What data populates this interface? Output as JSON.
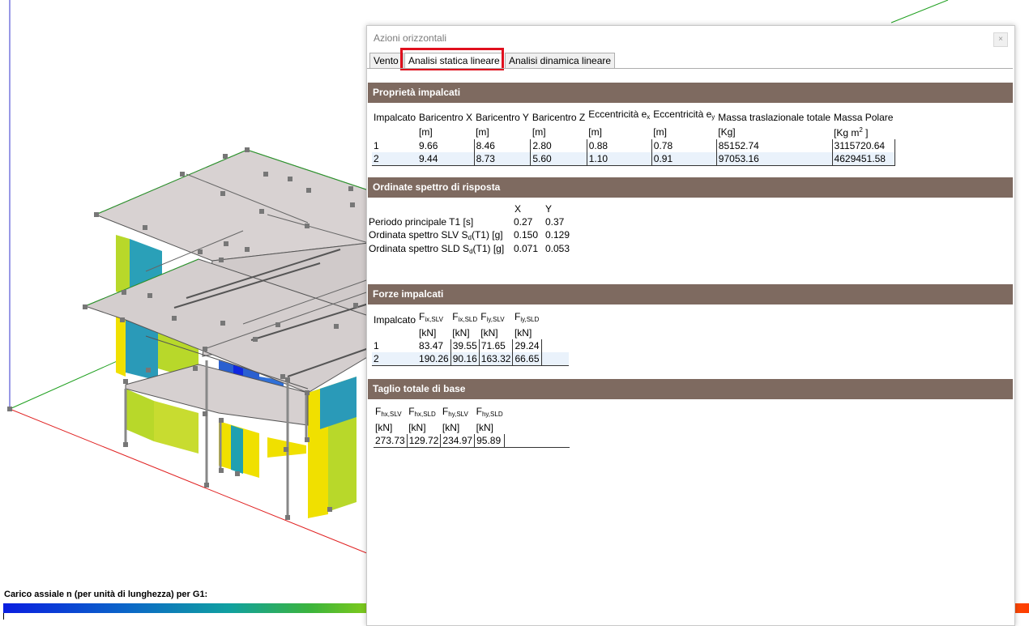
{
  "dialog": {
    "title": "Azioni orizzontali",
    "close": "×",
    "tabs": [
      "Vento",
      "Analisi statica lineare",
      "Analisi dinamica lineare"
    ],
    "active_tab": "Analisi statica lineare"
  },
  "impalcati": {
    "header": "Proprietà impalcati",
    "col_names": [
      "Impalcato",
      "Baricentro X",
      "Baricentro Y",
      "Baricentro Z",
      "Eccentricità e",
      "Eccentricità e",
      "Massa traslazionale totale",
      "Massa Polare"
    ],
    "col_subs": [
      "",
      "",
      "",
      "",
      "x",
      "y",
      "",
      ""
    ],
    "units": [
      "",
      "[m]",
      "[m]",
      "[m]",
      "[m]",
      "[m]",
      "[Kg]",
      "[Kg m"
    ],
    "mass_polar_unit_sup": "2",
    "mass_polar_unit_end": " ]",
    "rows": [
      [
        "1",
        "9.66",
        "8.46",
        "2.80",
        "0.88",
        "0.78",
        "85152.74",
        "3115720.64"
      ],
      [
        "2",
        "9.44",
        "8.73",
        "5.60",
        "1.10",
        "0.91",
        "97053.16",
        "4629451.58"
      ]
    ]
  },
  "spettro": {
    "header": "Ordinate spettro di risposta",
    "col_x": "X",
    "col_y": "Y",
    "rows": [
      {
        "label": "Periodo principale T1 [s]",
        "x": "0.27",
        "y": "0.37"
      },
      {
        "label": "Ordinata spettro   SLV S",
        "sub": "d",
        "label_end": "(T1) [g]",
        "x": "0.150",
        "y": "0.129"
      },
      {
        "label": "Ordinata spettro   SLD S",
        "sub": "d",
        "label_end": "(T1) [g]",
        "x": "0.071",
        "y": "0.053"
      }
    ]
  },
  "forze": {
    "header": "Forze impalcati",
    "col_main": [
      "Impalcato",
      "F",
      "F",
      "F",
      "F"
    ],
    "col_subs": [
      "",
      "ix,SLV",
      "ix,SLD",
      "iy,SLV",
      "iy,SLD"
    ],
    "units": [
      "",
      "[kN]",
      "[kN]",
      "[kN]",
      "[kN]"
    ],
    "rows": [
      [
        "1",
        "83.47",
        "39.55",
        "71.65",
        "29.24"
      ],
      [
        "2",
        "190.26",
        "90.16",
        "163.32",
        "66.65"
      ]
    ]
  },
  "taglio": {
    "header": "Taglio totale di base",
    "col_main": [
      "F",
      "F",
      "F",
      "F"
    ],
    "col_subs": [
      "hx,SLV",
      "hx,SLD",
      "hy,SLV",
      "hy,SLD"
    ],
    "units": [
      "[kN]",
      "[kN]",
      "[kN]",
      "[kN]"
    ],
    "row": [
      "273.73",
      "129.72",
      "234.97",
      "95.89"
    ]
  },
  "legend": {
    "label": "Carico assiale n (per unità di lunghezza) per G1:"
  },
  "colors": {
    "section_header": "#7e6a60",
    "highlight": "#e0101e",
    "selected_row": "#eaf2fb"
  }
}
